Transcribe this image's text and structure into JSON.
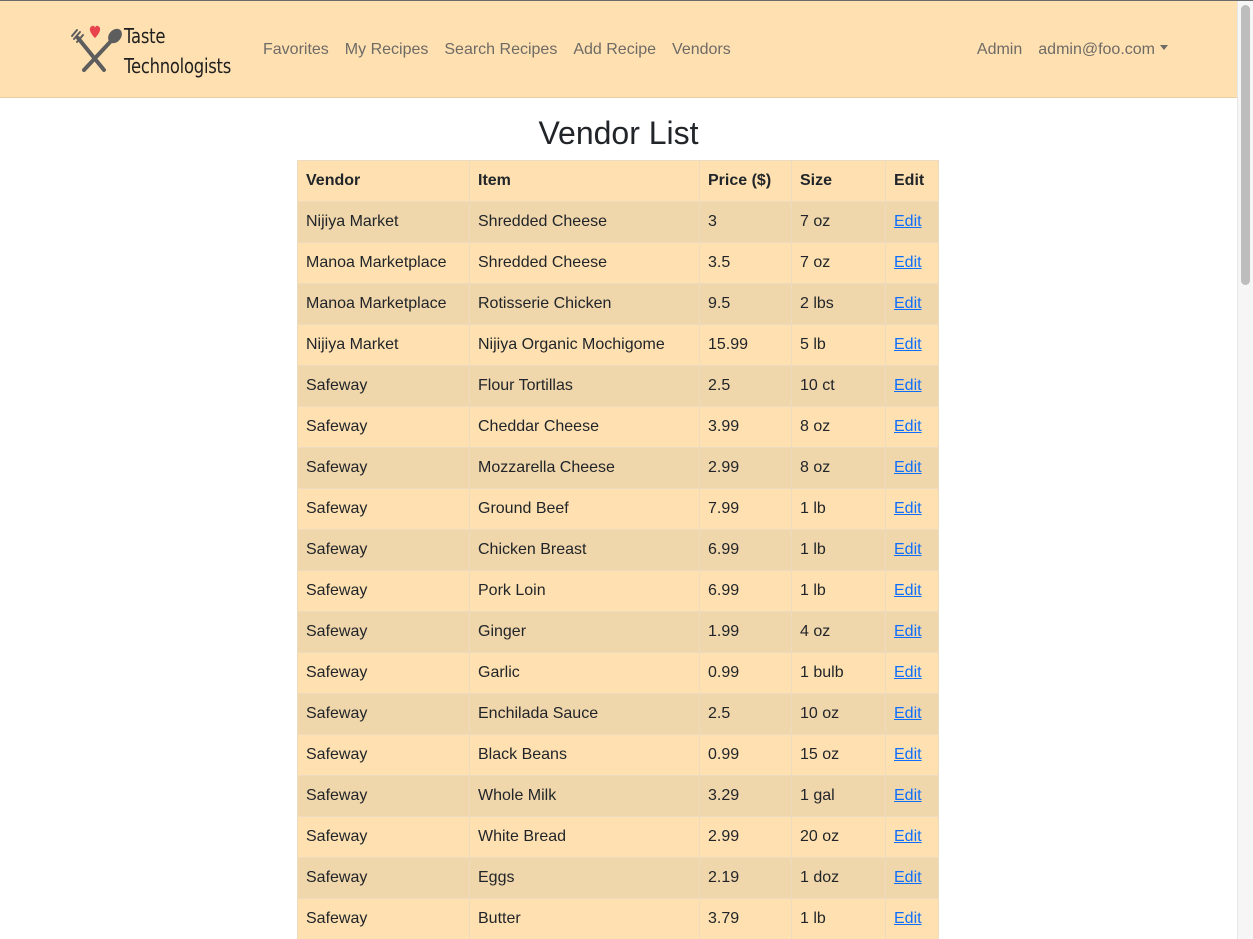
{
  "navbar": {
    "brand_line1": "Taste",
    "brand_line2": "Technologists",
    "links": [
      "Favorites",
      "My Recipes",
      "Search Recipes",
      "Add Recipe",
      "Vendors"
    ],
    "admin_label": "Admin",
    "user_email": "admin@foo.com"
  },
  "page": {
    "title": "Vendor List"
  },
  "table": {
    "headers": [
      "Vendor",
      "Item",
      "Price ($)",
      "Size",
      "Edit"
    ],
    "rows": [
      {
        "vendor": "Nijiya Market",
        "item": "Shredded Cheese",
        "price": "3",
        "size": "7 oz",
        "edit": "Edit"
      },
      {
        "vendor": "Manoa Marketplace",
        "item": "Shredded Cheese",
        "price": "3.5",
        "size": "7 oz",
        "edit": "Edit"
      },
      {
        "vendor": "Manoa Marketplace",
        "item": "Rotisserie Chicken",
        "price": "9.5",
        "size": "2 lbs",
        "edit": "Edit"
      },
      {
        "vendor": "Nijiya Market",
        "item": "Nijiya Organic Mochigome",
        "price": "15.99",
        "size": "5 lb",
        "edit": "Edit"
      },
      {
        "vendor": "Safeway",
        "item": "Flour Tortillas",
        "price": "2.5",
        "size": "10 ct",
        "edit": "Edit"
      },
      {
        "vendor": "Safeway",
        "item": "Cheddar Cheese",
        "price": "3.99",
        "size": "8 oz",
        "edit": "Edit"
      },
      {
        "vendor": "Safeway",
        "item": "Mozzarella Cheese",
        "price": "2.99",
        "size": "8 oz",
        "edit": "Edit"
      },
      {
        "vendor": "Safeway",
        "item": "Ground Beef",
        "price": "7.99",
        "size": "1 lb",
        "edit": "Edit"
      },
      {
        "vendor": "Safeway",
        "item": "Chicken Breast",
        "price": "6.99",
        "size": "1 lb",
        "edit": "Edit"
      },
      {
        "vendor": "Safeway",
        "item": "Pork Loin",
        "price": "6.99",
        "size": "1 lb",
        "edit": "Edit"
      },
      {
        "vendor": "Safeway",
        "item": "Ginger",
        "price": "1.99",
        "size": "4 oz",
        "edit": "Edit"
      },
      {
        "vendor": "Safeway",
        "item": "Garlic",
        "price": "0.99",
        "size": "1 bulb",
        "edit": "Edit"
      },
      {
        "vendor": "Safeway",
        "item": "Enchilada Sauce",
        "price": "2.5",
        "size": "10 oz",
        "edit": "Edit"
      },
      {
        "vendor": "Safeway",
        "item": "Black Beans",
        "price": "0.99",
        "size": "15 oz",
        "edit": "Edit"
      },
      {
        "vendor": "Safeway",
        "item": "Whole Milk",
        "price": "3.29",
        "size": "1 gal",
        "edit": "Edit"
      },
      {
        "vendor": "Safeway",
        "item": "White Bread",
        "price": "2.99",
        "size": "20 oz",
        "edit": "Edit"
      },
      {
        "vendor": "Safeway",
        "item": "Eggs",
        "price": "2.19",
        "size": "1 doz",
        "edit": "Edit"
      },
      {
        "vendor": "Safeway",
        "item": "Butter",
        "price": "3.79",
        "size": "1 lb",
        "edit": "Edit"
      }
    ]
  },
  "colors": {
    "navbar_bg": "#ffe1b1",
    "row_dark": "#f0d6ab",
    "row_light": "#ffe1b1",
    "link": "#0d6efd",
    "heart": "#e8434c"
  },
  "icons": {
    "brand_logo": "fork-spoon-heart-icon",
    "dropdown": "caret-down-icon"
  }
}
